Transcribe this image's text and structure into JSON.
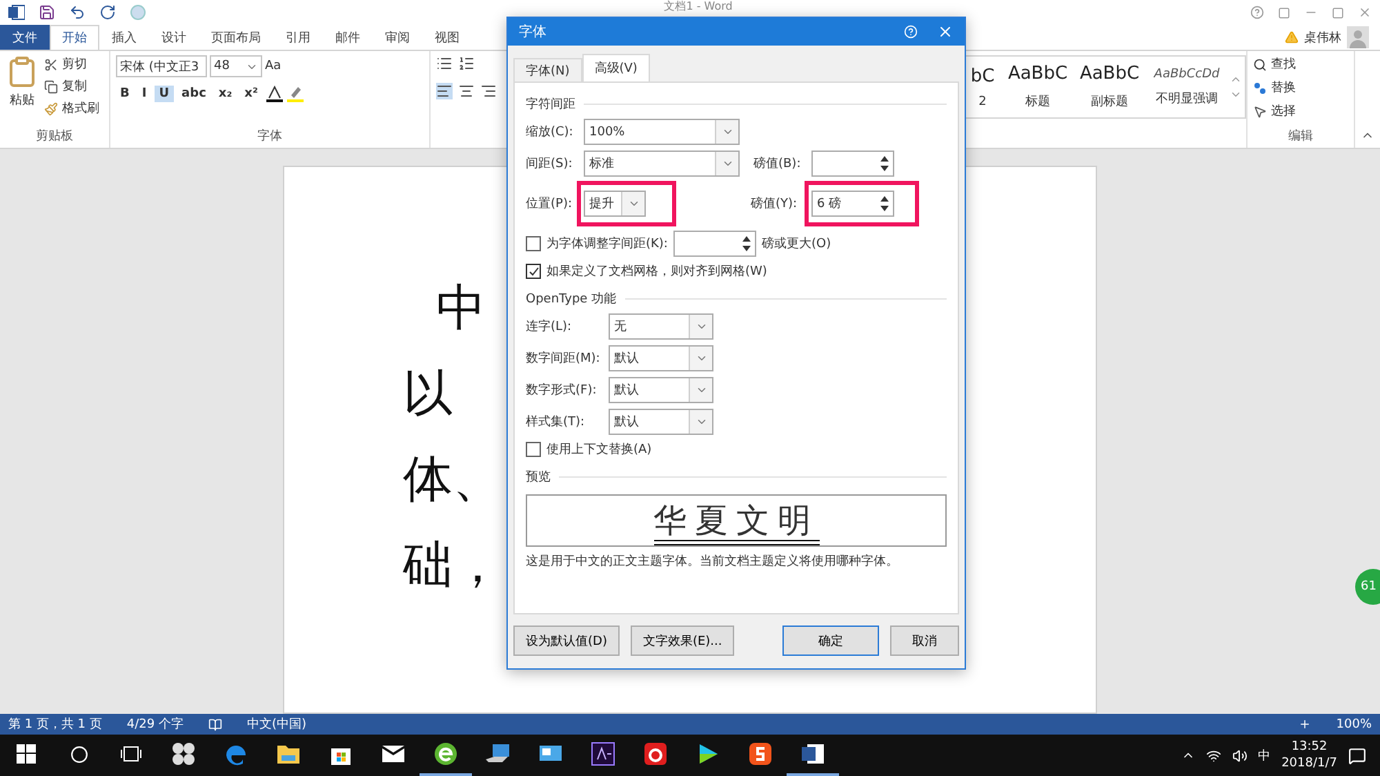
{
  "window": {
    "title": "文档1 - Word",
    "user": "桌伟林"
  },
  "ribbon_tabs": [
    {
      "label": "文件",
      "kind": "file",
      "selected": false
    },
    {
      "label": "开始",
      "kind": "tab",
      "selected": true
    },
    {
      "label": "插入",
      "kind": "tab",
      "selected": false
    },
    {
      "label": "设计",
      "kind": "tab",
      "selected": false
    },
    {
      "label": "页面布局",
      "kind": "tab",
      "selected": false
    },
    {
      "label": "引用",
      "kind": "tab",
      "selected": false
    },
    {
      "label": "邮件",
      "kind": "tab",
      "selected": false
    },
    {
      "label": "审阅",
      "kind": "tab",
      "selected": false
    },
    {
      "label": "视图",
      "kind": "tab",
      "selected": false
    }
  ],
  "clipboard": {
    "paste": "粘贴",
    "cut": "剪切",
    "copy": "复制",
    "format_painter": "格式刷",
    "group": "剪贴板"
  },
  "font": {
    "name": "宋体 (中文正3",
    "size": "48",
    "case": "Aa",
    "format_buttons": [
      "B",
      "I",
      "U",
      "abc",
      "x₂",
      "x²"
    ],
    "underline_selected": true,
    "group": "字体"
  },
  "styles": [
    {
      "sample": "bC",
      "label": "2",
      "italic": false
    },
    {
      "sample": "AaBbC",
      "label": "标题",
      "italic": false
    },
    {
      "sample": "AaBbC",
      "label": "副标题",
      "italic": false
    },
    {
      "sample": "AaBbCcDd",
      "label": "不明显强调",
      "italic": true
    }
  ],
  "editing": {
    "find": "查找",
    "replace": "替换",
    "select": "选择",
    "group": "编辑"
  },
  "document": {
    "lines": [
      "中",
      "以",
      "体、",
      "础，"
    ]
  },
  "side_badge": "61",
  "status_bar": {
    "page": "第 1 页，共 1 页",
    "words": "4/29 个字",
    "language": "中文(中国)",
    "zoom": "100%"
  },
  "taskbar": {
    "apps": [
      {
        "kind": "fan",
        "running": false
      },
      {
        "kind": "edge",
        "running": false
      },
      {
        "kind": "folder",
        "running": false
      },
      {
        "kind": "store",
        "running": false
      },
      {
        "kind": "mail",
        "running": false
      },
      {
        "kind": "green-browser",
        "running": true
      },
      {
        "kind": "laptop",
        "running": false
      },
      {
        "kind": "screen",
        "running": false
      },
      {
        "kind": "ae",
        "running": false
      },
      {
        "kind": "music",
        "running": false
      },
      {
        "kind": "video",
        "running": false
      },
      {
        "kind": "sogou",
        "running": false
      },
      {
        "kind": "word",
        "running": true
      }
    ],
    "ime": "中",
    "time": "13:52",
    "date": "2018/1/7"
  },
  "dialog": {
    "title": "字体",
    "tabs": [
      {
        "label": "字体(N)",
        "selected": false
      },
      {
        "label": "高级(V)",
        "selected": true
      }
    ],
    "spacing_section": "字符间距",
    "scale": {
      "label": "缩放(C):",
      "value": "100%"
    },
    "spacing": {
      "label": "间距(S):",
      "value": "标准",
      "points_label": "磅值(B):"
    },
    "position": {
      "label": "位置(P):",
      "value": "提升",
      "points_label": "磅值(Y):",
      "points": "6 磅"
    },
    "kerning": {
      "label": "为字体调整字间距(K):",
      "checked": false,
      "suffix": "磅或更大(O)"
    },
    "grid": {
      "label": "如果定义了文档网格，则对齐到网格(W)",
      "checked": true
    },
    "opentype_section": "OpenType 功能",
    "opentype_rows": [
      {
        "label": "连字(L):",
        "value": "无"
      },
      {
        "label": "数字间距(M):",
        "value": "默认"
      },
      {
        "label": "数字形式(F):",
        "value": "默认"
      },
      {
        "label": "样式集(T):",
        "value": "默认"
      }
    ],
    "contextual": {
      "label": "使用上下文替换(A)",
      "checked": false
    },
    "preview_section": "预览",
    "preview_text": "华夏文明",
    "description": "这是用于中文的正文主题字体。当前文档主题定义将使用哪种字体。",
    "buttons": [
      {
        "label": "设为默认值(D)",
        "default": false
      },
      {
        "label": "文字效果(E)...",
        "default": false
      },
      {
        "label": "确定",
        "default": true
      },
      {
        "label": "取消",
        "default": false
      }
    ]
  }
}
